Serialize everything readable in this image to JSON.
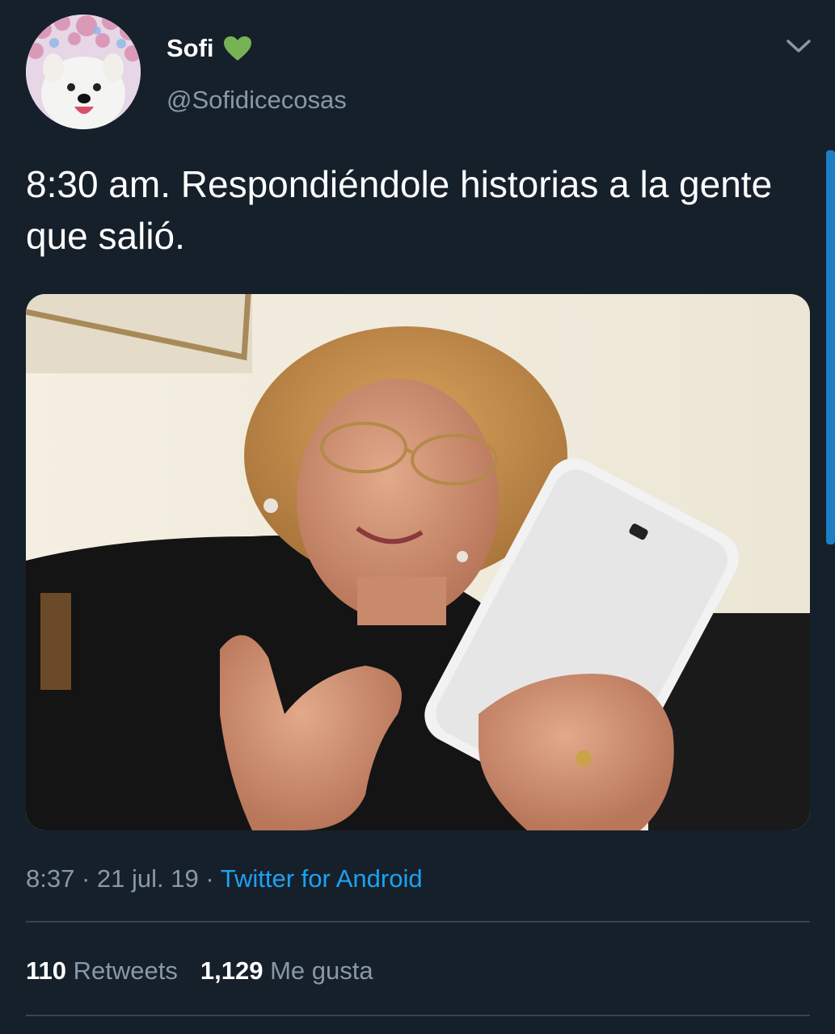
{
  "tweet": {
    "display_name": "Sofi",
    "handle": "@Sofidicecosas",
    "text": "8:30 am. Respondiéndole historias a la gente que salió.",
    "time": "8:37",
    "date": "21 jul. 19",
    "separator": "·",
    "source": "Twitter for Android",
    "retweets_count": "110",
    "retweets_label": "Retweets",
    "likes_count": "1,129",
    "likes_label": "Me gusta"
  },
  "icons": {
    "name_emoji": "green-heart-icon",
    "menu": "chevron-down-icon"
  },
  "colors": {
    "background": "#15202b",
    "text_primary": "#ffffff",
    "text_secondary": "#8899a6",
    "link": "#1da1f2",
    "divider": "#38444d",
    "heart": "#77b255"
  }
}
